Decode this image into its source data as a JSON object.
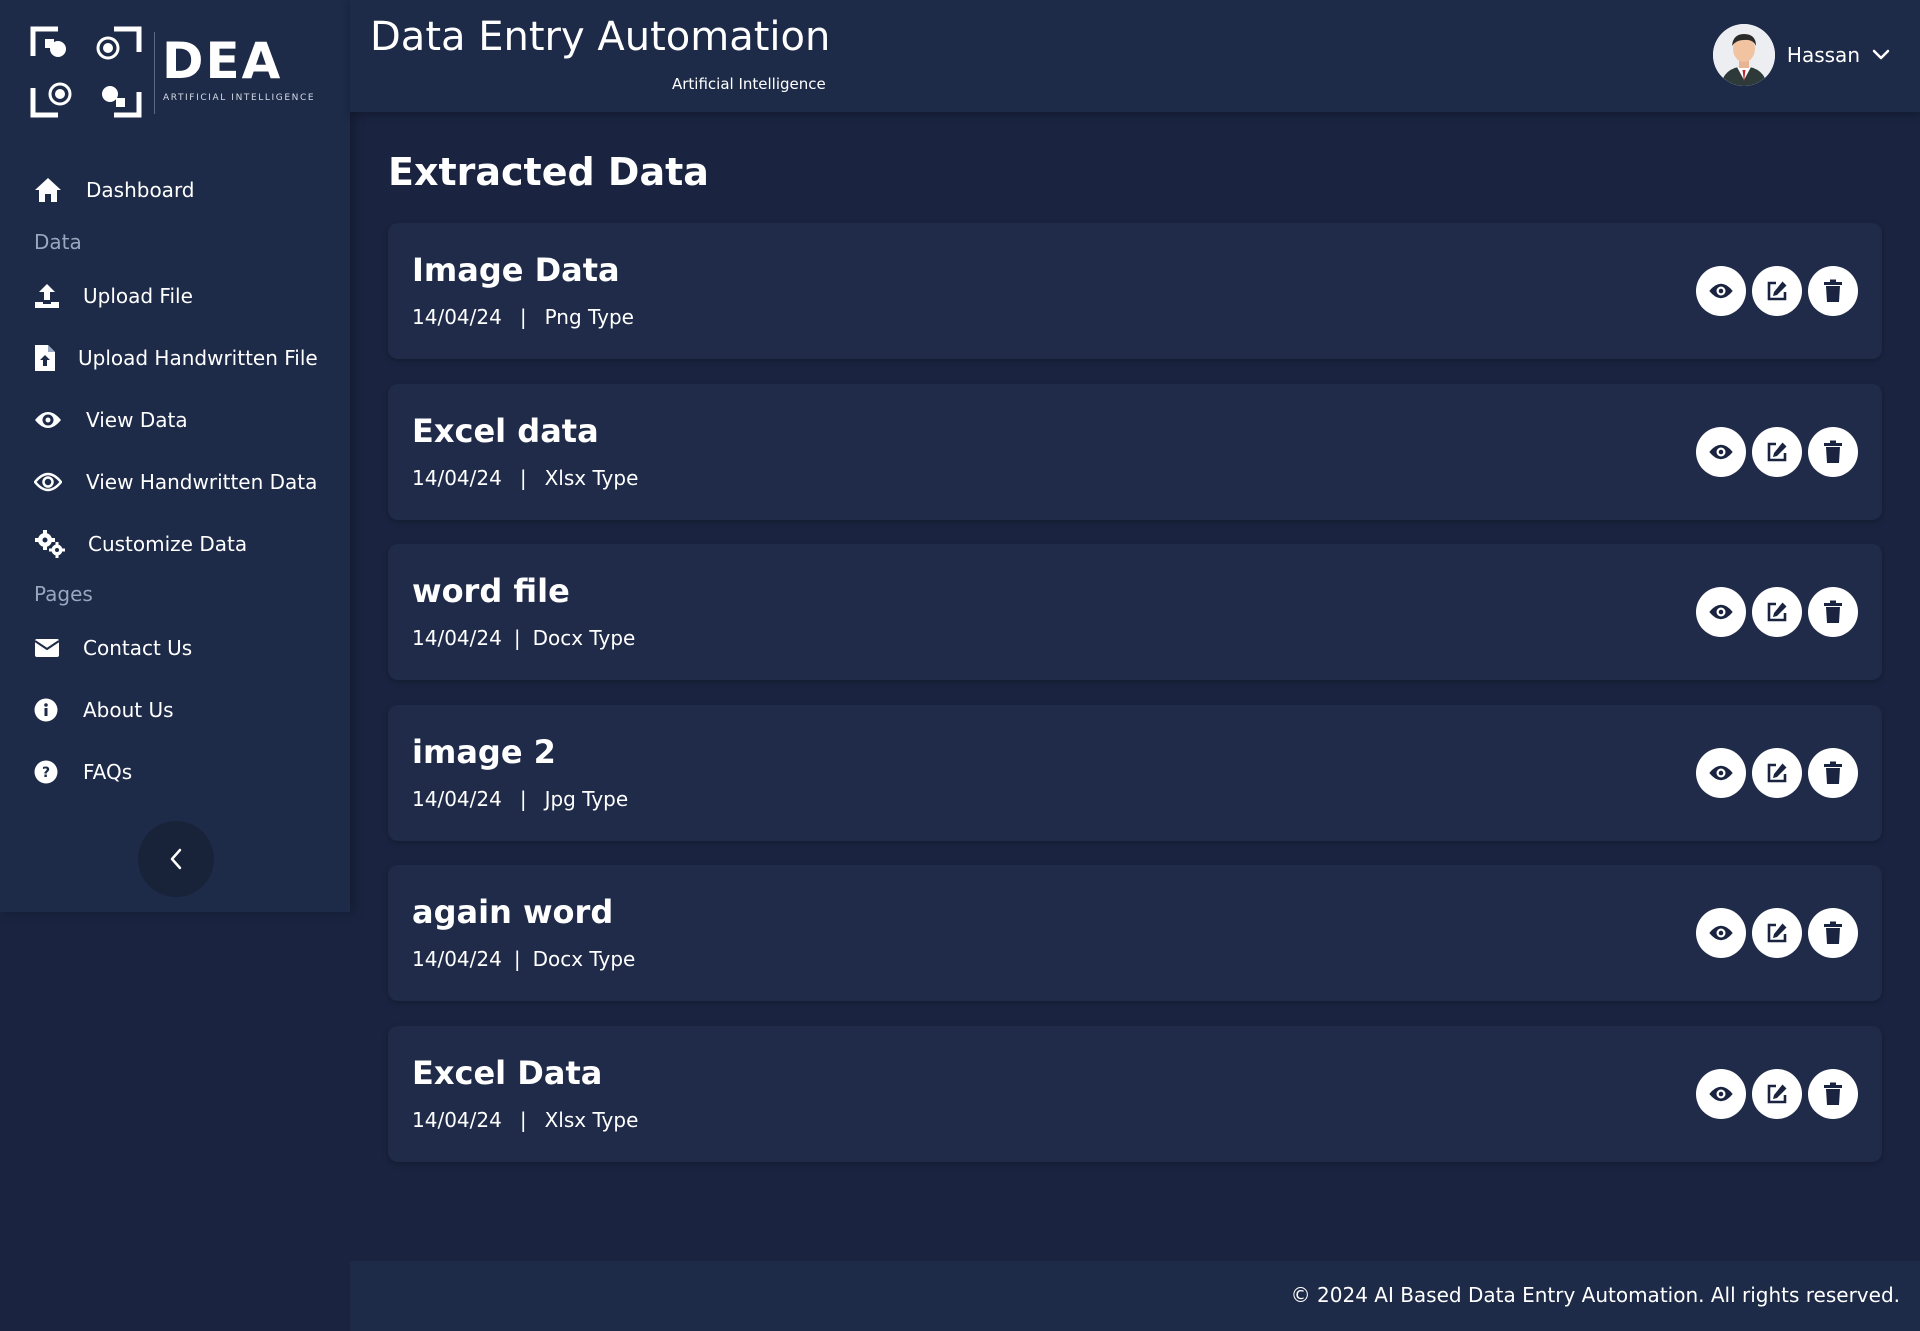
{
  "brand": {
    "name": "DEA",
    "tagline": "ARTIFICIAL INTELLIGENCE"
  },
  "header": {
    "title": "Data Entry Automation",
    "subtitle": "Artificial Intelligence",
    "user_name": "Hassan"
  },
  "sidebar": {
    "items": [
      {
        "label": "Dashboard",
        "icon": "home-icon"
      },
      {
        "label": "Upload File",
        "icon": "upload-icon"
      },
      {
        "label": "Upload Handwritten File",
        "icon": "file-upload-icon"
      },
      {
        "label": "View Data",
        "icon": "eye-icon"
      },
      {
        "label": "View Handwritten Data",
        "icon": "eye-icon"
      },
      {
        "label": "Customize Data",
        "icon": "gears-icon"
      },
      {
        "label": "Contact Us",
        "icon": "envelope-icon"
      },
      {
        "label": "About Us",
        "icon": "info-icon"
      },
      {
        "label": "FAQs",
        "icon": "question-icon"
      }
    ],
    "sections": {
      "data": "Data",
      "pages": "Pages"
    }
  },
  "main": {
    "title": "Extracted Data",
    "cards": [
      {
        "title": "Image Data",
        "date": "14/04/24",
        "type": "Png Type"
      },
      {
        "title": "Excel data",
        "date": "14/04/24",
        "type": "Xlsx Type"
      },
      {
        "title": "word file",
        "date": "14/04/24",
        "type": "Docx Type"
      },
      {
        "title": "image 2",
        "date": "14/04/24",
        "type": "Jpg Type"
      },
      {
        "title": "again word",
        "date": "14/04/24",
        "type": "Docx Type"
      },
      {
        "title": "Excel Data",
        "date": "14/04/24",
        "type": "Xlsx Type"
      }
    ],
    "separator": "|"
  },
  "footer": {
    "text": "© 2024 AI Based Data Entry Automation. All rights reserved."
  },
  "colors": {
    "background": "#1a2440",
    "panel": "#1d2a48",
    "card": "#1f2b49",
    "button": "#ffffff",
    "icon_dark": "#1a2440"
  }
}
